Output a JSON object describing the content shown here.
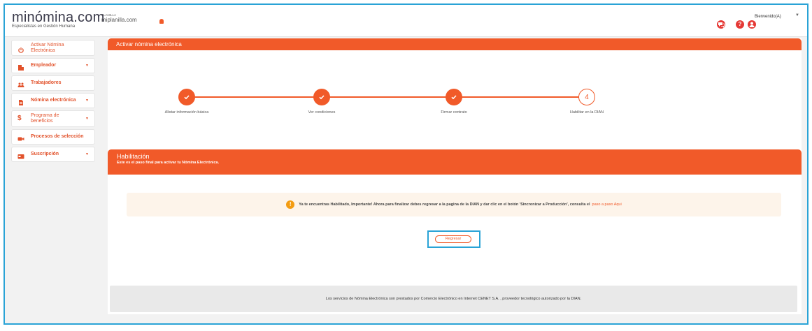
{
  "header": {
    "logo_text": "minómina.com",
    "logo_tagline": "Especialistas en Gestión Humana",
    "partner_prefix": "PLANILLA",
    "partner_name": "miplanilla.com",
    "welcome": "Bienvenido(A)",
    "icons": [
      "chat-icon",
      "help-icon",
      "user-icon",
      "chevron-down-icon"
    ]
  },
  "sidebar": {
    "items": [
      {
        "label": "Activar Nómina Electrónica",
        "icon": "power-icon",
        "has_caret": false
      },
      {
        "label": "Empleador",
        "icon": "building-icon",
        "has_caret": true
      },
      {
        "label": "Trabajadores",
        "icon": "users-icon",
        "has_caret": false
      },
      {
        "label": "Nómina electrónica",
        "icon": "document-icon",
        "has_caret": true
      },
      {
        "label": "Programa de beneficios",
        "icon": "dollar-icon",
        "has_caret": true
      },
      {
        "label": "Procesos de selección",
        "icon": "video-icon",
        "has_caret": false
      },
      {
        "label": "Suscripción",
        "icon": "card-icon",
        "has_caret": true
      }
    ]
  },
  "main": {
    "title": "Activar nómina electrónica",
    "steps": [
      {
        "label": "Alistar información básica",
        "state": "done"
      },
      {
        "label": "Ver condiciones",
        "state": "done"
      },
      {
        "label": "Firmar contrato",
        "state": "done"
      },
      {
        "label": "Habilitar en la DIAN",
        "state": "current",
        "number": "4"
      }
    ],
    "section_title": "Habilitación",
    "section_subtitle": "Este es el paso final para activar tu Nómina Electrónica.",
    "alert_text": "Ya te encuentras Habilitado, Importante! Ahora para finalizar debes regresar a la pagina de la DIAN y dar clic en el botón 'Sincronizar a Producción', consulta el",
    "alert_link": "paso a paso Aqui",
    "back_button": "Regresar",
    "footer": "Los servicios de Nómina Electrónica son prestados por Comercio Electrónico en Internet CENET S.A. , proveedor tecnológico autorizado por la DIAN."
  },
  "colors": {
    "accent": "#f15a29",
    "highlight_border": "#2aa3d6",
    "alert_bg": "#fdf4ea",
    "footer_bg": "#e9e9e9"
  }
}
